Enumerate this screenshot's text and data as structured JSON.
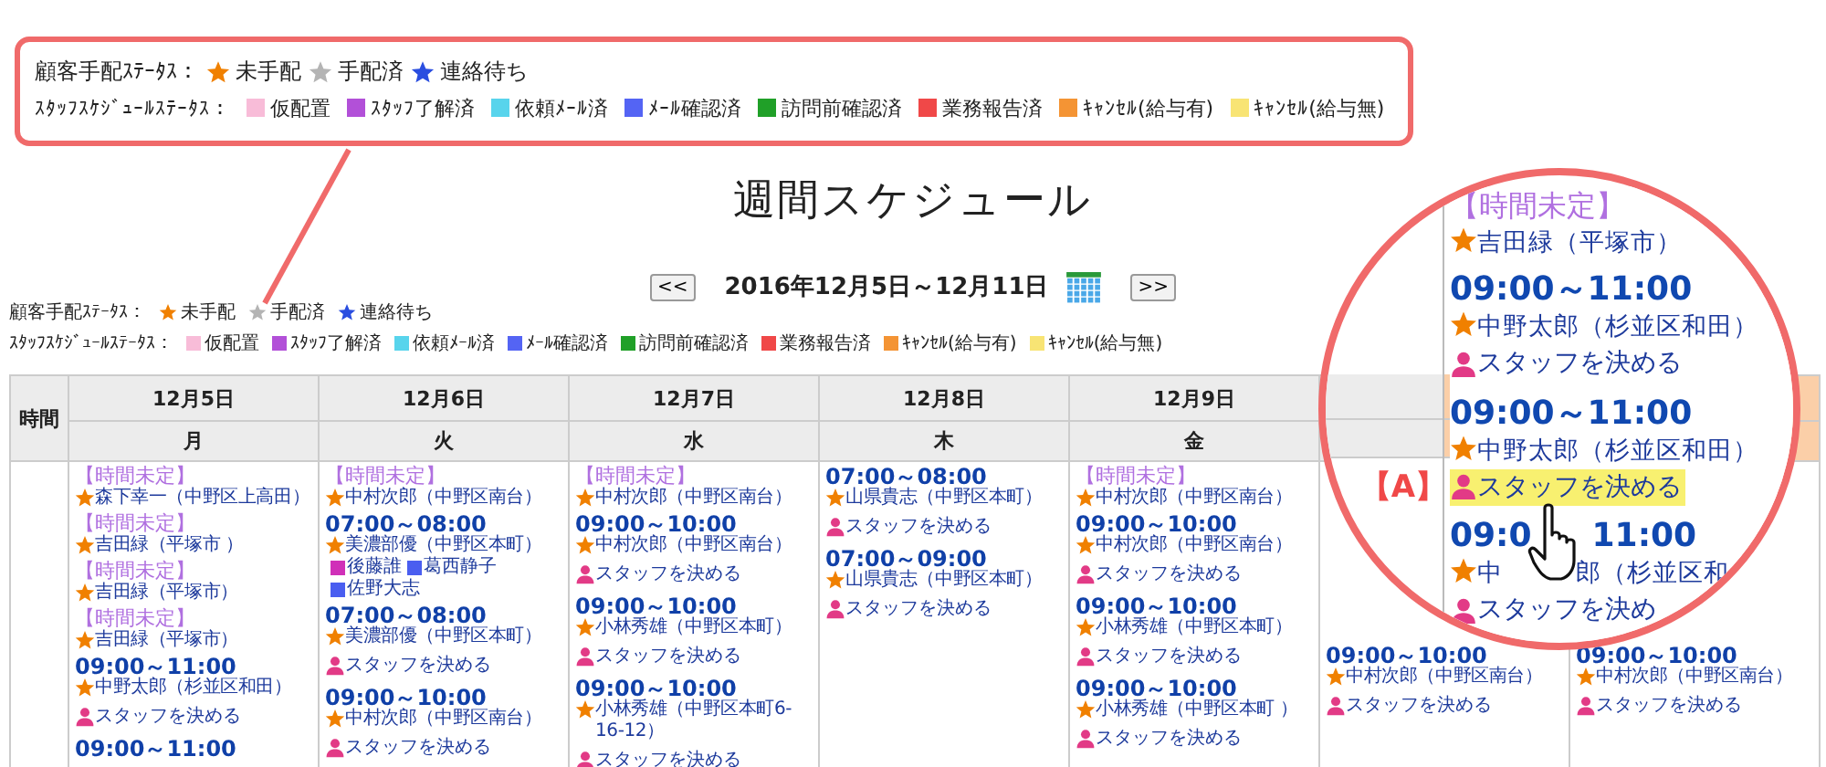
{
  "callout_legend": {
    "customer_status": {
      "label": "顧客手配ｽﾃｰﾀｽ：",
      "items": [
        {
          "label": "未手配",
          "color": "#f08000"
        },
        {
          "label": "手配済",
          "color": "#b4b4b4"
        },
        {
          "label": "連絡待ち",
          "color": "#2a4ee0"
        }
      ]
    },
    "staff_status": {
      "label": "ｽﾀｯﾌｽｹｼﾞｭｰﾙｽﾃｰﾀｽ：",
      "items": [
        {
          "label": "仮配置",
          "color": "#f8bcd8"
        },
        {
          "label": "ｽﾀｯﾌ了解済",
          "color": "#b250d8"
        },
        {
          "label": "依頼ﾒｰﾙ済",
          "color": "#58d4ec"
        },
        {
          "label": "ﾒｰﾙ確認済",
          "color": "#5464f4"
        },
        {
          "label": "訪問前確認済",
          "color": "#20a028"
        },
        {
          "label": "業務報告済",
          "color": "#f04848"
        },
        {
          "label": "ｷｬﾝｾﾙ(給与有)",
          "color": "#f49434"
        },
        {
          "label": "ｷｬﾝｾﾙ(給与無)",
          "color": "#f8e474"
        }
      ]
    }
  },
  "title": "週間スケジュール",
  "week_nav": {
    "prev": "<<",
    "range": "2016年12月5日～12月11日",
    "next": ">>"
  },
  "legend": {
    "customer_status": {
      "label": "顧客手配ｽﾃｰﾀｽ：",
      "items": [
        {
          "label": "未手配",
          "color": "#f08000"
        },
        {
          "label": "手配済",
          "color": "#b4b4b4"
        },
        {
          "label": "連絡待ち",
          "color": "#2a4ee0"
        }
      ]
    },
    "staff_status": {
      "label": "ｽﾀｯﾌｽｹｼﾞｭｰﾙｽﾃｰﾀｽ：",
      "items": [
        {
          "label": "仮配置",
          "color": "#f8bcd8"
        },
        {
          "label": "ｽﾀｯﾌ了解済",
          "color": "#b250d8"
        },
        {
          "label": "依頼ﾒｰﾙ済",
          "color": "#58d4ec"
        },
        {
          "label": "ﾒｰﾙ確認済",
          "color": "#5464f4"
        },
        {
          "label": "訪問前確認済",
          "color": "#20a028"
        },
        {
          "label": "業務報告済",
          "color": "#f04848"
        },
        {
          "label": "ｷｬﾝｾﾙ(給与有)",
          "color": "#f49434"
        },
        {
          "label": "ｷｬﾝｾﾙ(給与無)",
          "color": "#f8e474"
        }
      ]
    }
  },
  "table": {
    "time_header": "時間",
    "days": [
      {
        "date": "12月5日",
        "weekday": "月",
        "highlighted": false,
        "entries": [
          {
            "kind": "undecided",
            "time": "【時間未定】",
            "customer": {
              "name": "森下幸一（中野区上高田）",
              "color": "#f08000"
            }
          },
          {
            "kind": "undecided",
            "time": "【時間未定】",
            "customer": {
              "name": "吉田緑（平塚市 ）",
              "color": "#f08000"
            }
          },
          {
            "kind": "undecided",
            "time": "【時間未定】",
            "customer": {
              "name": "吉田緑（平塚市）",
              "color": "#f08000"
            }
          },
          {
            "kind": "undecided",
            "time": "【時間未定】",
            "customer": {
              "name": "吉田緑（平塚市）",
              "color": "#f08000"
            }
          },
          {
            "kind": "scheduled",
            "time": "09:00～11:00",
            "customer": {
              "name": "中野太郎（杉並区和田）",
              "color": "#f08000"
            },
            "assign": "スタッフを決める"
          },
          {
            "kind": "scheduled",
            "time": "09:00～11:00"
          }
        ]
      },
      {
        "date": "12月6日",
        "weekday": "火",
        "highlighted": false,
        "entries": [
          {
            "kind": "undecided",
            "time": "【時間未定】",
            "customer": {
              "name": "中村次郎（中野区南台）",
              "color": "#f08000"
            }
          },
          {
            "kind": "scheduled",
            "time": "07:00～08:00",
            "customer": {
              "name": "美濃部優（中野区本町）",
              "color": "#f08000"
            },
            "staff": [
              {
                "name": "後藤誰",
                "color": "#d030b8"
              },
              {
                "name": "葛西静子",
                "color": "#4a5ef0"
              },
              {
                "name": "佐野大志",
                "color": "#4a5ef0"
              }
            ]
          },
          {
            "kind": "scheduled",
            "time": "07:00～08:00",
            "customer": {
              "name": "美濃部優（中野区本町）",
              "color": "#f08000"
            },
            "assign": "スタッフを決める"
          },
          {
            "kind": "scheduled",
            "time": "09:00～10:00",
            "customer": {
              "name": "中村次郎（中野区南台）",
              "color": "#f08000"
            },
            "assign": "スタッフを決める"
          }
        ]
      },
      {
        "date": "12月7日",
        "weekday": "水",
        "highlighted": false,
        "entries": [
          {
            "kind": "undecided",
            "time": "【時間未定】",
            "customer": {
              "name": "中村次郎（中野区南台）",
              "color": "#f08000"
            }
          },
          {
            "kind": "scheduled",
            "time": "09:00～10:00",
            "customer": {
              "name": "中村次郎（中野区南台）",
              "color": "#f08000"
            },
            "assign": "スタッフを決める"
          },
          {
            "kind": "scheduled",
            "time": "09:00～10:00",
            "customer": {
              "name": "小林秀雄（中野区本町）",
              "color": "#f08000"
            },
            "assign": "スタッフを決める"
          },
          {
            "kind": "scheduled",
            "time": "09:00～10:00",
            "customer": {
              "name": "小林秀雄（中野区本町6-16-12）",
              "color": "#f08000"
            },
            "assign": "スタッフを決める"
          }
        ]
      },
      {
        "date": "12月8日",
        "weekday": "木",
        "highlighted": false,
        "entries": [
          {
            "kind": "scheduled",
            "time": "07:00～08:00",
            "customer": {
              "name": "山県貴志（中野区本町）",
              "color": "#f08000"
            },
            "assign": "スタッフを決める"
          },
          {
            "kind": "scheduled",
            "time": "07:00～09:00",
            "customer": {
              "name": "山県貴志（中野区本町）",
              "color": "#f08000"
            },
            "assign": "スタッフを決める"
          }
        ]
      },
      {
        "date": "12月9日",
        "weekday": "金",
        "highlighted": false,
        "entries": [
          {
            "kind": "undecided",
            "time": "【時間未定】",
            "customer": {
              "name": "中村次郎（中野区南台）",
              "color": "#f08000"
            }
          },
          {
            "kind": "scheduled",
            "time": "09:00～10:00",
            "customer": {
              "name": "中村次郎（中野区南台）",
              "color": "#f08000"
            },
            "assign": "スタッフを決める"
          },
          {
            "kind": "scheduled",
            "time": "09:00～10:00",
            "customer": {
              "name": "小林秀雄（中野区本町）",
              "color": "#f08000"
            },
            "assign": "スタッフを決める"
          },
          {
            "kind": "scheduled",
            "time": "09:00～10:00",
            "customer": {
              "name": "小林秀雄（中野区本町 ）",
              "color": "#f08000"
            },
            "assign": "スタッフを決める"
          }
        ]
      },
      {
        "highlighted": false,
        "entries": [
          {
            "kind": "scheduled",
            "time": "09:00～10:00",
            "customer": {
              "name": "中村次郎（中野区南台）",
              "color": "#f08000"
            },
            "assign": "スタッフを決める"
          }
        ]
      },
      {
        "highlighted": true,
        "entries": [
          {
            "kind": "scheduled",
            "time": "09:00～10:00",
            "customer": {
              "name": "中村次郎（中野区南台）",
              "color": "#f08000"
            },
            "assign": "スタッフを決める"
          }
        ]
      }
    ]
  },
  "magnifier": {
    "marker": "【A】",
    "entries": [
      {
        "kind": "undecided",
        "time": "【時間未定】",
        "customer": {
          "name": "吉田緑（平塚市）",
          "color": "#f08000"
        }
      },
      {
        "kind": "scheduled",
        "time": "09:00～11:00",
        "customer": {
          "name": "中野太郎（杉並区和田）",
          "color": "#f08000"
        },
        "assign": "スタッフを決める",
        "highlighted": false
      },
      {
        "kind": "scheduled",
        "time": "09:00～11:00",
        "customer": {
          "name": "中野太郎（杉並区和田）",
          "color": "#f08000"
        },
        "assign": "スタッフを決める",
        "highlighted": true
      },
      {
        "kind": "scheduled",
        "time_parts": [
          "09:0",
          "11:00"
        ],
        "customer": {
          "name_parts": [
            "中",
            "郎（杉並区和"
          ],
          "color": "#f08000"
        },
        "assign": "スタッフを決め",
        "highlighted": false,
        "cursor": true
      }
    ]
  }
}
